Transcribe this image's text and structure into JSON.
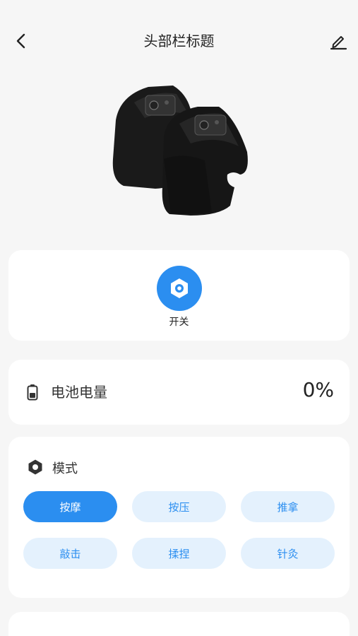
{
  "header": {
    "title": "头部栏标题",
    "back_icon": "chevron-left-icon",
    "edit_icon": "edit-pencil-icon"
  },
  "product": {
    "image": "knee-pad-pair-illustration"
  },
  "power": {
    "label": "开关",
    "icon": "hexagon-nut-icon",
    "color": "#2b8ef0"
  },
  "battery": {
    "label": "电池电量",
    "value": "0%",
    "icon": "battery-icon"
  },
  "mode": {
    "title": "模式",
    "icon": "hexagon-mode-icon",
    "selected": "按摩",
    "options": [
      "按摩",
      "按压",
      "推拿",
      "敲击",
      "揉捏",
      "针灸"
    ]
  },
  "colors": {
    "accent": "#2b8ef0",
    "chip_bg": "#e4f1fd",
    "page_bg": "#f6f6f6"
  }
}
